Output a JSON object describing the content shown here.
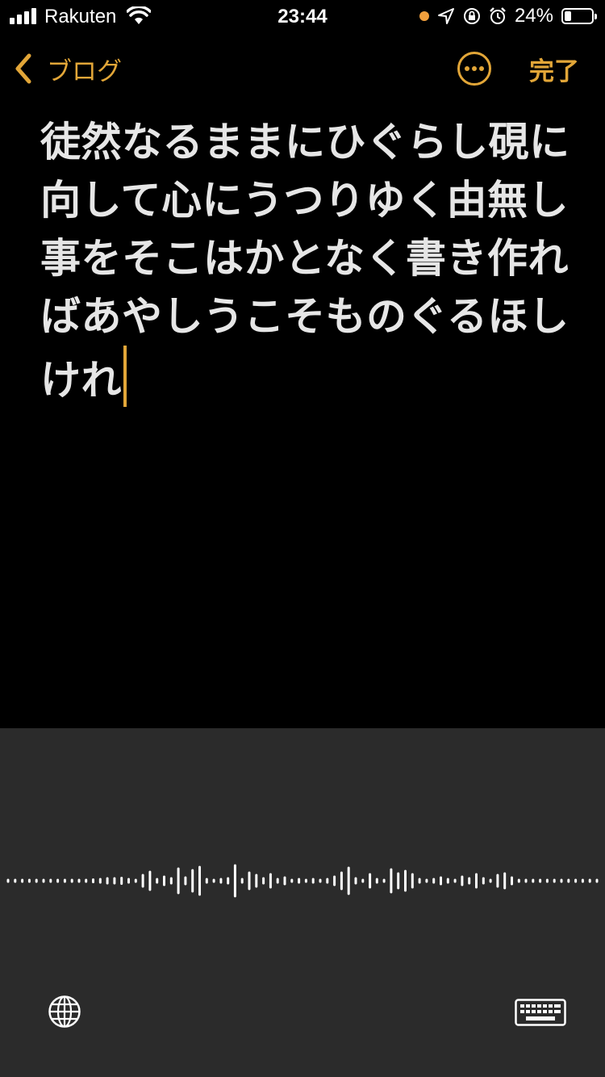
{
  "status_bar": {
    "carrier": "Rakuten",
    "time": "23:44",
    "battery_percent": "24%",
    "battery_level": 0.24,
    "mic_indicator_color": "#f2a03d"
  },
  "nav": {
    "back_label": "ブログ",
    "done_label": "完了",
    "accent_color": "#e2a638"
  },
  "note": {
    "text": "徒然なるままにひぐらし硯に向して心にうつりゆく由無し事をそこはかとなく書き作ればあやしうこそものぐるほしけれ"
  },
  "dictation": {
    "input_mode_icon": "globe-icon",
    "keyboard_icon": "keyboard-icon"
  }
}
